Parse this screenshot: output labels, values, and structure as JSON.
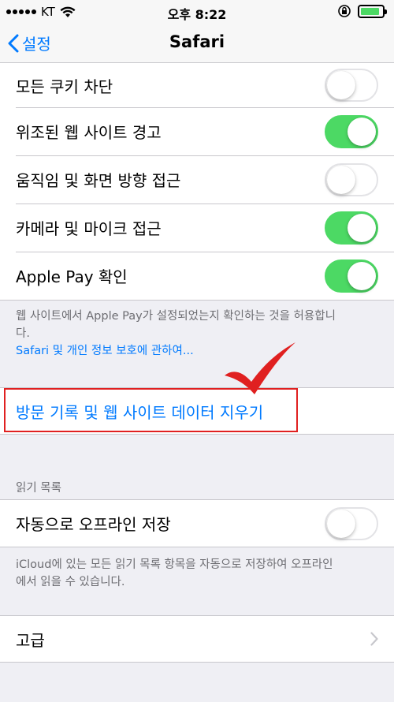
{
  "status_bar": {
    "carrier": "KT",
    "time": "오후 8:22"
  },
  "nav": {
    "back_label": "설정",
    "title": "Safari"
  },
  "privacy_rows": [
    {
      "label": "모든 쿠키 차단",
      "on": false
    },
    {
      "label": "위조된 웹 사이트 경고",
      "on": true
    },
    {
      "label": "움직임 및 화면 방향 접근",
      "on": false
    },
    {
      "label": "카메라 및 마이크 접근",
      "on": true
    },
    {
      "label": "Apple Pay 확인",
      "on": true
    }
  ],
  "privacy_footer": {
    "line1": "웹 사이트에서 Apple Pay가 설정되었는지 확인하는 것을 허용합니",
    "line2": "다.",
    "link": "Safari 및 개인 정보 보호에 관하여..."
  },
  "clear_history_label": "방문 기록 및 웹 사이트 데이터 지우기",
  "reading_list": {
    "header": "읽기 목록",
    "row_label": "자동으로 오프라인 저장",
    "row_on": false,
    "footer_line1": "iCloud에 있는 모든 읽기 목록 항목을 자동으로 저장하여 오프라인",
    "footer_line2": "에서 읽을 수 있습니다."
  },
  "advanced_label": "고급",
  "colors": {
    "accent": "#007aff",
    "toggle_on": "#4cd964",
    "annotation": "#e02020"
  }
}
